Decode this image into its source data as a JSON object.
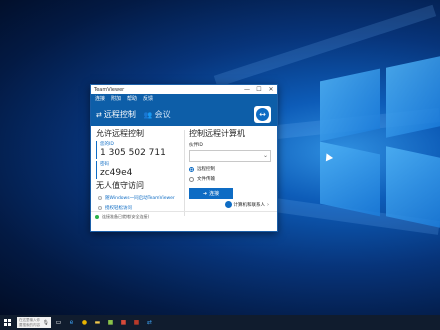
{
  "window": {
    "title": "TeamViewer",
    "controls": {
      "minimize": "—",
      "maximize": "☐",
      "close": "✕"
    }
  },
  "menu": {
    "items": [
      "连接",
      "附加",
      "帮助",
      "反馈"
    ]
  },
  "header": {
    "tab_remote": "远程控制",
    "tab_meeting": "会议"
  },
  "allow_remote": {
    "title": "允许远程控制",
    "id_label": "您的ID",
    "id_value": "1 305 502 711",
    "password_label": "密码",
    "password_value": "zc49e4"
  },
  "unattended": {
    "title": "无人值守访问",
    "options": [
      "随Windows一同启动TeamViewer",
      "授权轻松访问"
    ]
  },
  "control_remote": {
    "title": "控制远程计算机",
    "partner_label": "伙伴ID",
    "partner_value": "",
    "radio_remote": "远程控制",
    "radio_file": "文件传输",
    "connect_label": "连接"
  },
  "contacts_label": "计算机和联系人",
  "status_text": "连接准备已就绪(安全连接)",
  "taskbar": {
    "search_placeholder": "在这里输入你要搜索的内容",
    "tray_time": "",
    "icons": [
      "task-view-icon",
      "edge-icon",
      "chrome-icon",
      "explorer-icon",
      "store-icon",
      "app-icon",
      "app-icon-2",
      "teamviewer-icon"
    ]
  },
  "colors": {
    "accent": "#0e6cc4",
    "header": "#0d5ea8",
    "status_ok": "#2cb34a"
  }
}
